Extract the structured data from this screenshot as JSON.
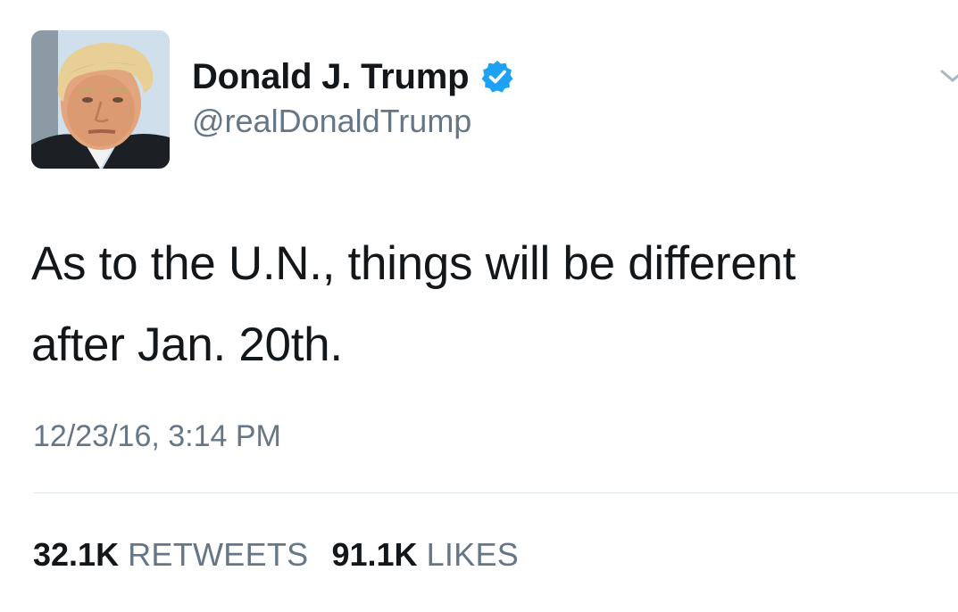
{
  "author": {
    "display_name": "Donald J. Trump",
    "handle": "@realDonaldTrump",
    "verified": true,
    "avatar_icon": "profile-photo"
  },
  "tweet": {
    "text_line_1": "As to the U.N., things will be different",
    "text_line_2": "after Jan. 20th.",
    "timestamp": "12/23/16, 3:14 PM"
  },
  "stats": {
    "retweets_count": "32.1K",
    "retweets_label": "RETWEETS",
    "likes_count": "91.1K",
    "likes_label": "LIKES"
  },
  "colors": {
    "verified_blue": "#1da1f2",
    "primary_text": "#14171a",
    "secondary_text": "#657786",
    "divider": "#e1e8ed"
  }
}
